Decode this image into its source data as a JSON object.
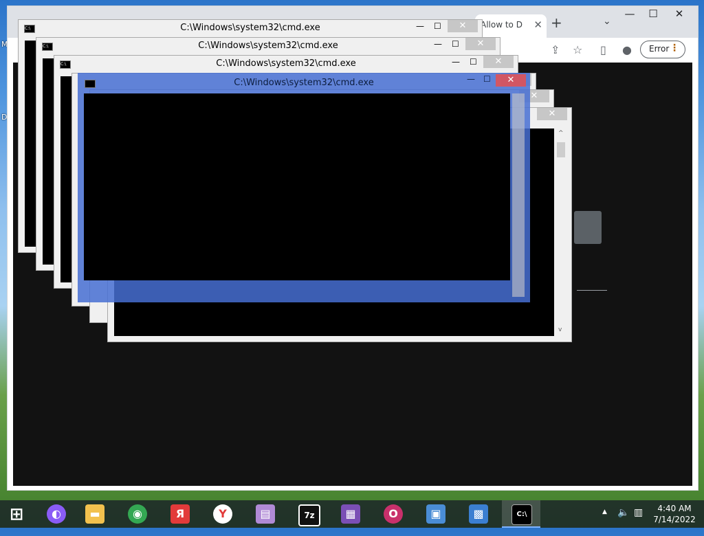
{
  "desktop": {
    "label_m": "M",
    "label_d": "D"
  },
  "browser": {
    "tab_title": "Allow to D",
    "tab_close": "✕",
    "new_tab": "+",
    "tab_search": "⌄",
    "minimize": "—",
    "maximize": "☐",
    "close": "✕",
    "error_label": "Error",
    "menu_dots": "⋮",
    "share_icon": "⇪",
    "star_icon": "☆",
    "sidepanel_icon": "▯",
    "profile_icon": "●"
  },
  "cmd": {
    "title": "C:\\Windows\\system32\\cmd.exe",
    "icon_text": "C:\\",
    "min": "—",
    "max": "☐",
    "close": "✕",
    "arrow_up": "^",
    "arrow_down": "v"
  },
  "taskbar": {
    "start_icon": "⊞",
    "apps": [
      {
        "name": "alice",
        "glyph": "◐",
        "color": "#8a5cf6"
      },
      {
        "name": "file-explorer",
        "glyph": "▬",
        "color": "#f2c14e"
      },
      {
        "name": "chrome",
        "glyph": "◉",
        "color": "#34a853"
      },
      {
        "name": "yandex-browser",
        "glyph": "Я",
        "color": "#e23a3a"
      },
      {
        "name": "yandex",
        "glyph": "Y",
        "color": "#e23a3a"
      },
      {
        "name": "winrar",
        "glyph": "▤",
        "color": "#b08ad6"
      },
      {
        "name": "7zip",
        "glyph": "7z",
        "color": "#111111"
      },
      {
        "name": "dotnet",
        "glyph": "▦",
        "color": "#7b4fb5"
      },
      {
        "name": "opera",
        "glyph": "O",
        "color": "#c9306b"
      },
      {
        "name": "photos",
        "glyph": "▣",
        "color": "#4a8dd6"
      },
      {
        "name": "control-panel",
        "glyph": "▩",
        "color": "#3b7fd1"
      },
      {
        "name": "cmd",
        "glyph": "C:\\",
        "color": "#000000"
      }
    ],
    "tray_up": "▲",
    "tray_volume": "🔈",
    "tray_network": "▥",
    "time": "4:40 AM",
    "date": "7/14/2022"
  }
}
